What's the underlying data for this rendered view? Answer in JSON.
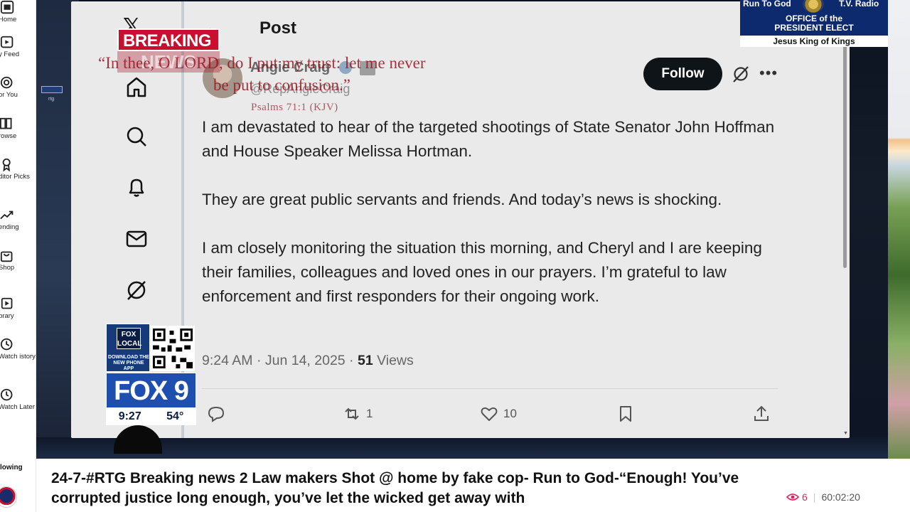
{
  "leftnav": {
    "items": [
      {
        "label": "Home",
        "icon": "home-icon"
      },
      {
        "label": "y Feed",
        "icon": "feed-icon"
      },
      {
        "label": "or You",
        "icon": "for-you-icon"
      },
      {
        "label": "rowse",
        "icon": "browse-icon"
      },
      {
        "label": "ditor Picks",
        "icon": "editor-picks-icon"
      },
      {
        "label": "ending",
        "icon": "trending-icon"
      },
      {
        "label": "Shop",
        "icon": "shop-icon"
      },
      {
        "label": "brary",
        "icon": "library-icon"
      },
      {
        "label": "Watch istory",
        "icon": "history-icon"
      },
      {
        "label": "Watch Later",
        "icon": "clock-icon"
      }
    ],
    "following_label": "lowing"
  },
  "video": {
    "rtg_small_label": "rtg",
    "breaking": {
      "top": "BREAKING",
      "bottom": "NEWS"
    },
    "verse": {
      "line1": "“In thee, O LORD, do I put my trust: let me never",
      "line2": "be put to confusion.”",
      "ref": "Psalms 71:1 (KJV)"
    },
    "corner": {
      "left": "Run To God",
      "right": "T.V. Radio",
      "office1": "OFFICE of the",
      "office2": "PRESIDENT ELECT",
      "tagline": "Jesus King of Kings"
    },
    "fox": {
      "local_logo": "FOX LOCAL",
      "download": "DOWNLOAD THE NEW PHONE APP",
      "channel": "FOX 9",
      "time": "9:27",
      "temp": "54°"
    }
  },
  "tweet": {
    "header": "Post",
    "author_name": "Angie Craig",
    "author_handle": "@RepAngieCraig",
    "follow_label": "Follow",
    "paragraphs": [
      "I am devastated to hear of the targeted shootings of State Senator John Hoffman and House Speaker Melissa Hortman.",
      "They are great public servants and friends. And today’s news is shocking.",
      "I am closely monitoring the situation this morning, and Cheryl and I are keeping their families, colleagues and loved ones in our prayers. I’m grateful to law enforcement and first responders for their ongoing work."
    ],
    "timestamp": "9:24 AM · Jun 14, 2025 · ",
    "views_count": "51",
    "views_label": " Views",
    "actions": {
      "reposts": "1",
      "likes": "10"
    }
  },
  "bottom": {
    "title": "24-7-#RTG Breaking news 2 Law makers Shot @ home by fake cop- Run to God-“Enough! You’ve corrupted justice long enough, you’ve let the wicked get away with",
    "view_count": "6",
    "duration": "60:02:20"
  },
  "colors": {
    "breaking_red": "#c8102e",
    "fox_blue": "#1f4fae",
    "follow_black": "#0f1419",
    "corner_blue": "#0e2a6e"
  }
}
